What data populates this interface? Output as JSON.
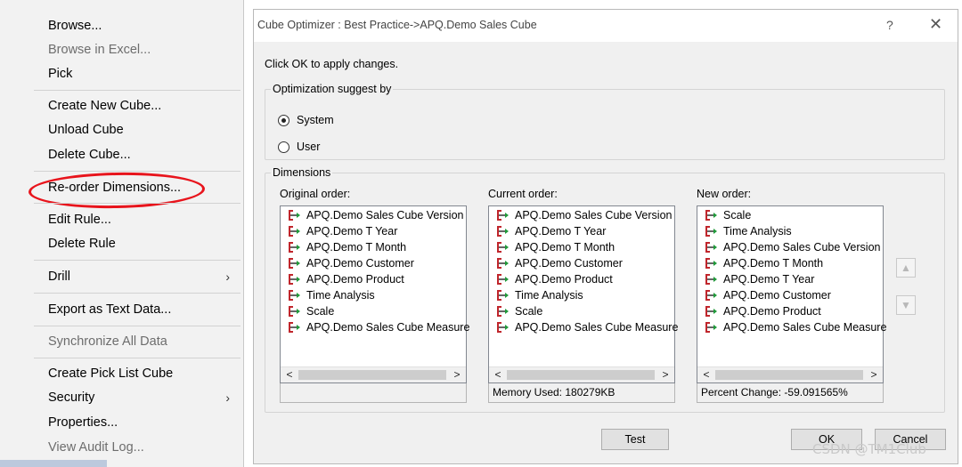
{
  "context_menu": {
    "items": [
      {
        "label": "Browse...",
        "disabled": false
      },
      {
        "label": "Browse in Excel...",
        "disabled": true
      },
      {
        "label": "Pick",
        "disabled": false
      },
      {
        "label": "Create New Cube...",
        "disabled": false
      },
      {
        "label": "Unload Cube",
        "disabled": false
      },
      {
        "label": "Delete Cube...",
        "disabled": false
      },
      {
        "label": "Re-order Dimensions...",
        "disabled": false
      },
      {
        "label": "Edit Rule...",
        "disabled": false
      },
      {
        "label": "Delete Rule",
        "disabled": false
      },
      {
        "label": "Drill",
        "disabled": false,
        "submenu": true
      },
      {
        "label": "Export as Text Data...",
        "disabled": false
      },
      {
        "label": "Synchronize All Data",
        "disabled": true
      },
      {
        "label": "Create Pick List Cube",
        "disabled": false
      },
      {
        "label": "Security",
        "disabled": false,
        "submenu": true
      },
      {
        "label": "Properties...",
        "disabled": false
      },
      {
        "label": "View Audit Log...",
        "disabled": true
      }
    ],
    "submenu_arrow": "›",
    "highlight_color": "#e8141c"
  },
  "dialog": {
    "title": "Cube Optimizer : Best Practice->APQ.Demo Sales Cube",
    "help_glyph": "?",
    "close_glyph": "✕",
    "instruction": "Click OK to apply changes.",
    "optimization": {
      "group_label": "Optimization suggest by",
      "options": [
        {
          "label": "System",
          "checked": true
        },
        {
          "label": "User",
          "checked": false
        }
      ]
    },
    "dimensions": {
      "group_label": "Dimensions",
      "original": {
        "label": "Original order:",
        "items": [
          "APQ.Demo Sales Cube Version",
          "APQ.Demo T Year",
          "APQ.Demo T Month",
          "APQ.Demo Customer",
          "APQ.Demo Product",
          "Time Analysis",
          "Scale",
          "APQ.Demo Sales Cube Measure"
        ],
        "status": ""
      },
      "current": {
        "label": "Current order:",
        "items": [
          "APQ.Demo Sales Cube Version",
          "APQ.Demo T Year",
          "APQ.Demo T Month",
          "APQ.Demo Customer",
          "APQ.Demo Product",
          "Time Analysis",
          "Scale",
          "APQ.Demo Sales Cube Measure"
        ],
        "status": "Memory Used: 180279KB"
      },
      "new": {
        "label": "New order:",
        "items": [
          "Scale",
          "Time Analysis",
          "APQ.Demo Sales Cube Version",
          "APQ.Demo T Month",
          "APQ.Demo T Year",
          "APQ.Demo Customer",
          "APQ.Demo Product",
          "APQ.Demo Sales Cube Measure"
        ],
        "status": "Percent Change: -59.091565%"
      },
      "scroll_left": "<",
      "scroll_right": ">",
      "move_up_glyph": "▲",
      "move_down_glyph": "▼"
    },
    "buttons": {
      "test": "Test",
      "ok": "OK",
      "cancel": "Cancel"
    },
    "icon_colors": {
      "red": "#c0262c",
      "green": "#1f9a3a",
      "dark": "#333333"
    }
  },
  "watermark": "CSDN @TM1Club"
}
